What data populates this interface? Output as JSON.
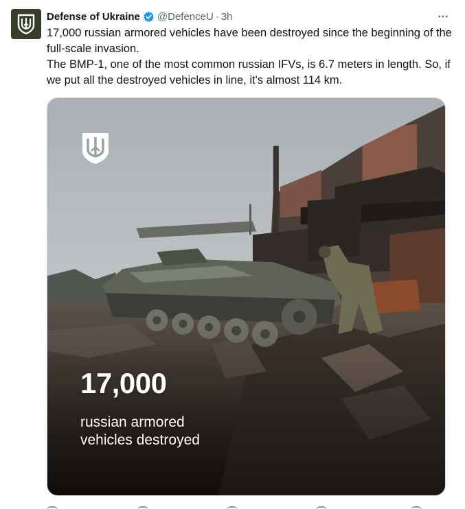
{
  "author": {
    "display_name": "Defense of Ukraine",
    "handle": "@DefenceU",
    "separator": "·",
    "time": "3h",
    "verified": true,
    "avatar_color": "#363d2a"
  },
  "tweet": {
    "paragraph_1": "17,000 russian armored vehicles have been destroyed since the beginning of the full-scale invasion.",
    "paragraph_2": "The BMP-1, one of the most common russian IFVs, is 6.7 meters in length. So, if we put all the destroyed vehicles in line, it's almost 114 km."
  },
  "media": {
    "stat_number": "17,000",
    "stat_caption_line1": "russian armored",
    "stat_caption_line2": "vehicles destroyed",
    "overlay_icon": "trident-shield-icon"
  },
  "icons": {
    "more": "more-horizontal-icon",
    "verified": "verified-badge-icon"
  },
  "colors": {
    "text_primary": "#0f1419",
    "text_secondary": "#536471",
    "verified_blue": "#1d9bf0"
  }
}
